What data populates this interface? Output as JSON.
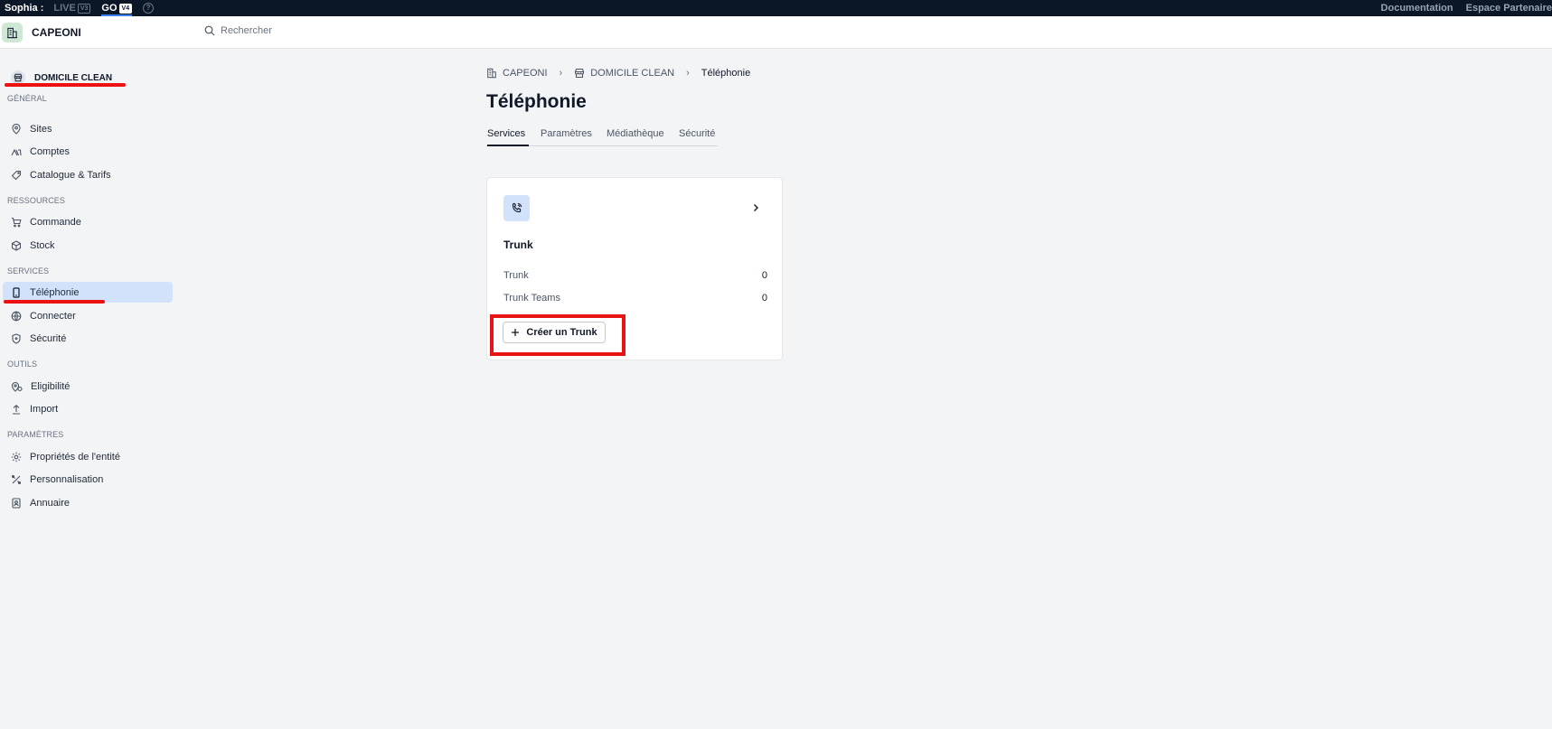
{
  "topbar": {
    "user": "Sophia :",
    "environments": [
      {
        "label": "LIVE",
        "version": "V3"
      },
      {
        "label": "GO",
        "version": "V4"
      }
    ],
    "links": [
      "Documentation",
      "Espace Partenaire"
    ]
  },
  "header": {
    "brand": "CAPEONI",
    "search_placeholder": "Rechercher"
  },
  "sidebar": {
    "entity": "DOMICILE CLEAN",
    "sections": {
      "general": "GÉNÉRAL",
      "ressources": "RESSOURCES",
      "services": "SERVICES",
      "outils": "OUTILS",
      "parametres": "PARAMÈTRES"
    },
    "items": {
      "sites": "Sites",
      "comptes": "Comptes",
      "catalogue": "Catalogue & Tarifs",
      "commande": "Commande",
      "stock": "Stock",
      "telephonie": "Téléphonie",
      "connecter": "Connecter",
      "securite": "Sécurité",
      "eligibilite": "Eligibilité",
      "import": "Import",
      "proprietes": "Propriétés de l'entité",
      "personnalisation": "Personnalisation",
      "annuaire": "Annuaire"
    },
    "active_item": "telephonie"
  },
  "breadcrumb": {
    "root": "CAPEONI",
    "entity": "DOMICILE CLEAN",
    "current": "Téléphonie"
  },
  "page": {
    "title": "Téléphonie",
    "tabs": [
      "Services",
      "Paramètres",
      "Médiathèque",
      "Sécurité"
    ],
    "active_tab": "Services"
  },
  "card": {
    "title": "Trunk",
    "stats": [
      {
        "label": "Trunk",
        "value": "0"
      },
      {
        "label": "Trunk Teams",
        "value": "0"
      }
    ],
    "button": "Créer un Trunk"
  },
  "colors": {
    "topbar": "#0b1627",
    "active_nav": "#d3e2fb",
    "annotation_red": "#e81313",
    "accent_blue": "#3b82f6"
  }
}
